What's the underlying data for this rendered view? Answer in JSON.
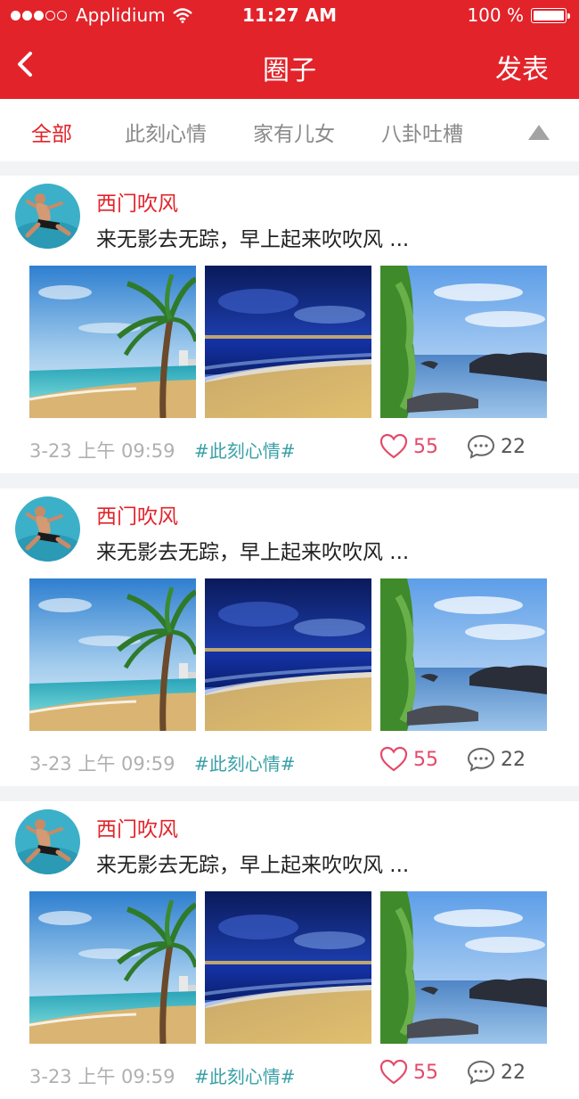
{
  "status_bar": {
    "carrier": "Applidium",
    "time": "11:27 AM",
    "battery": "100 %"
  },
  "nav": {
    "title": "圈子",
    "publish_label": "发表"
  },
  "tabs": [
    {
      "label": "全部",
      "active": true
    },
    {
      "label": "此刻心情",
      "active": false
    },
    {
      "label": "家有儿女",
      "active": false
    },
    {
      "label": "八卦吐槽",
      "active": false
    }
  ],
  "colors": {
    "brand": "#e2232a",
    "tag": "#3aa0a7",
    "like": "#e44a6a"
  },
  "posts": [
    {
      "username": "西门吹风",
      "content": "来无影去无踪，早上起来吹吹风 ...",
      "time": "3-23 上午 09:59",
      "tag": "#此刻心情#",
      "likes": "55",
      "comments": "22"
    },
    {
      "username": "西门吹风",
      "content": "来无影去无踪，早上起来吹吹风 ...",
      "time": "3-23 上午 09:59",
      "tag": "#此刻心情#",
      "likes": "55",
      "comments": "22"
    },
    {
      "username": "西门吹风",
      "content": "来无影去无踪，早上起来吹吹风 ...",
      "time": "3-23 上午 09:59",
      "tag": "#此刻心情#",
      "likes": "55",
      "comments": "22"
    }
  ]
}
